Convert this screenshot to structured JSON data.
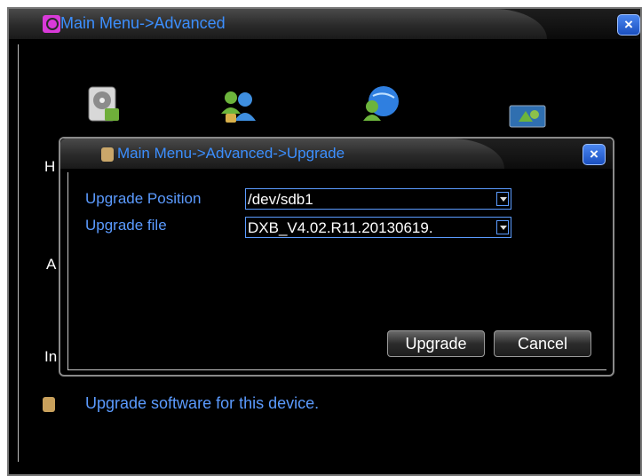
{
  "main_window": {
    "title": "Main Menu->Advanced",
    "close_label": "×",
    "side_letters": [
      "H",
      "A",
      "In"
    ]
  },
  "dialog": {
    "title": "Main Menu->Advanced->Upgrade",
    "close_label": "×",
    "fields": {
      "position_label": "Upgrade Position",
      "position_value": "/dev/sdb1",
      "file_label": "Upgrade file",
      "file_value": "DXB_V4.02.R11.20130619."
    },
    "buttons": {
      "upgrade": "Upgrade",
      "cancel": "Cancel"
    }
  },
  "status": {
    "text": "Upgrade software for this device."
  },
  "icons": [
    "hdd-icon",
    "account-icon",
    "network-icon",
    "display-icon"
  ]
}
